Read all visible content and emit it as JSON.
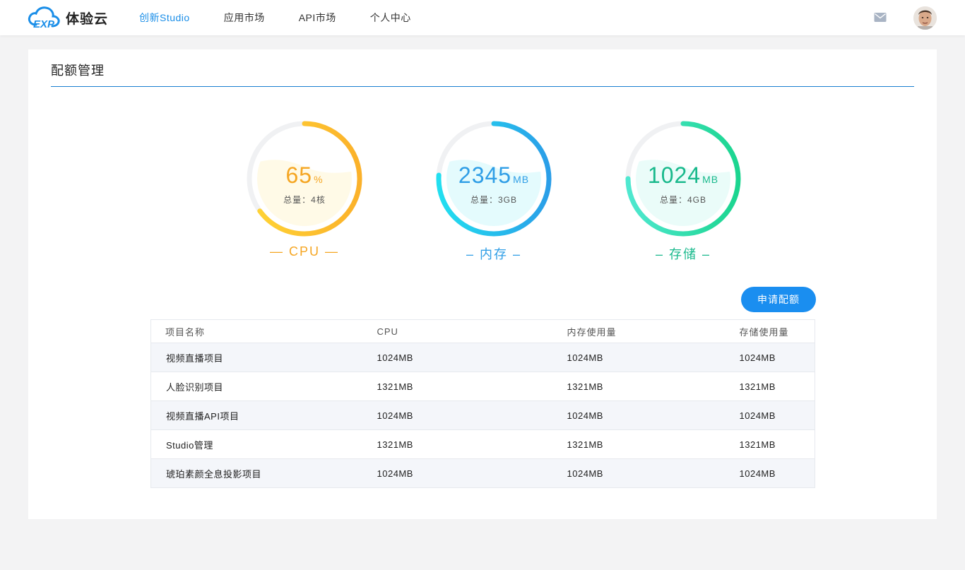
{
  "header": {
    "logo_text": "体验云",
    "nav": [
      {
        "label": "创新Studio",
        "active": true
      },
      {
        "label": "应用市场",
        "active": false
      },
      {
        "label": "API市场",
        "active": false
      },
      {
        "label": "个人中心",
        "active": false
      }
    ],
    "mail_icon": "mail-icon",
    "avatar": "user-avatar"
  },
  "page": {
    "title": "配额管理",
    "apply_button": "申请配额"
  },
  "gauges": [
    {
      "value": "65",
      "unit": "%",
      "total": "总量：4核",
      "label": "— CPU —",
      "percent": 65,
      "color_start": "#ffd536",
      "color_end": "#fbb12a",
      "text_color": "#f5a623"
    },
    {
      "value": "2345",
      "unit": "MB",
      "total": "总量：3GB",
      "label": "– 内存 –",
      "percent": 76,
      "color_start": "#22dff0",
      "color_end": "#2a9ee8",
      "text_color": "#2f9ee6"
    },
    {
      "value": "1024",
      "unit": "MB",
      "total": "总量：4GB",
      "label": "– 存储 –",
      "percent": 75,
      "color_start": "#4fe8d0",
      "color_end": "#1bd58f",
      "text_color": "#19b98c"
    }
  ],
  "table": {
    "headers": [
      "项目名称",
      "CPU",
      "内存使用量",
      "存储使用量"
    ],
    "rows": [
      [
        "视频直播项目",
        "1024MB",
        "1024MB",
        "1024MB"
      ],
      [
        "人脸识别项目",
        "1321MB",
        "1321MB",
        "1321MB"
      ],
      [
        "视频直播API项目",
        "1024MB",
        "1024MB",
        "1024MB"
      ],
      [
        "Studio管理",
        "1321MB",
        "1321MB",
        "1321MB"
      ],
      [
        "琥珀素颜全息投影项目",
        "1024MB",
        "1024MB",
        "1024MB"
      ]
    ]
  }
}
